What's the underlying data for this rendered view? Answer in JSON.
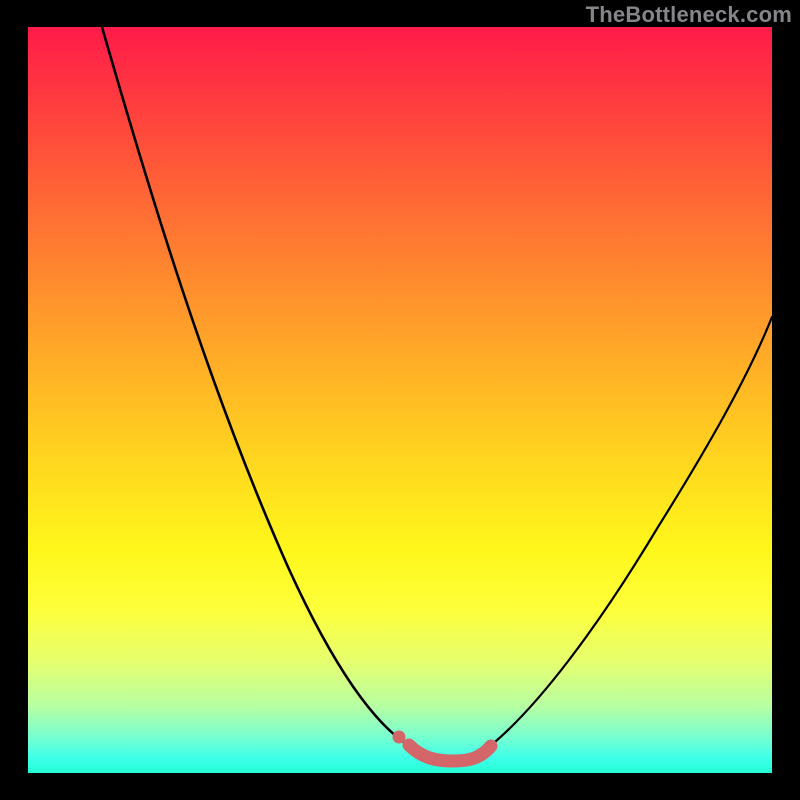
{
  "watermark": "TheBottleneck.com",
  "chart_data": {
    "type": "line",
    "title": "",
    "xlabel": "",
    "ylabel": "",
    "xlim": [
      0,
      100
    ],
    "ylim": [
      0,
      100
    ],
    "series": [
      {
        "name": "left-curve",
        "x": [
          10,
          15,
          20,
          25,
          30,
          35,
          40,
          45,
          48,
          50,
          51.5
        ],
        "y": [
          100,
          92,
          82,
          72,
          60,
          48,
          35,
          22,
          14,
          7,
          3.5
        ]
      },
      {
        "name": "right-curve",
        "x": [
          62,
          65,
          70,
          75,
          80,
          85,
          90,
          95,
          100
        ],
        "y": [
          3.5,
          7,
          14,
          22,
          31,
          40,
          48,
          55,
          62
        ]
      },
      {
        "name": "floor-highlight",
        "x": [
          51.5,
          53,
          55,
          57,
          59,
          61,
          62
        ],
        "y": [
          3.5,
          2.2,
          1.7,
          1.7,
          1.7,
          2.2,
          3.5
        ]
      }
    ],
    "colors": {
      "curve": "#000000",
      "highlight": "#d4666a"
    }
  }
}
